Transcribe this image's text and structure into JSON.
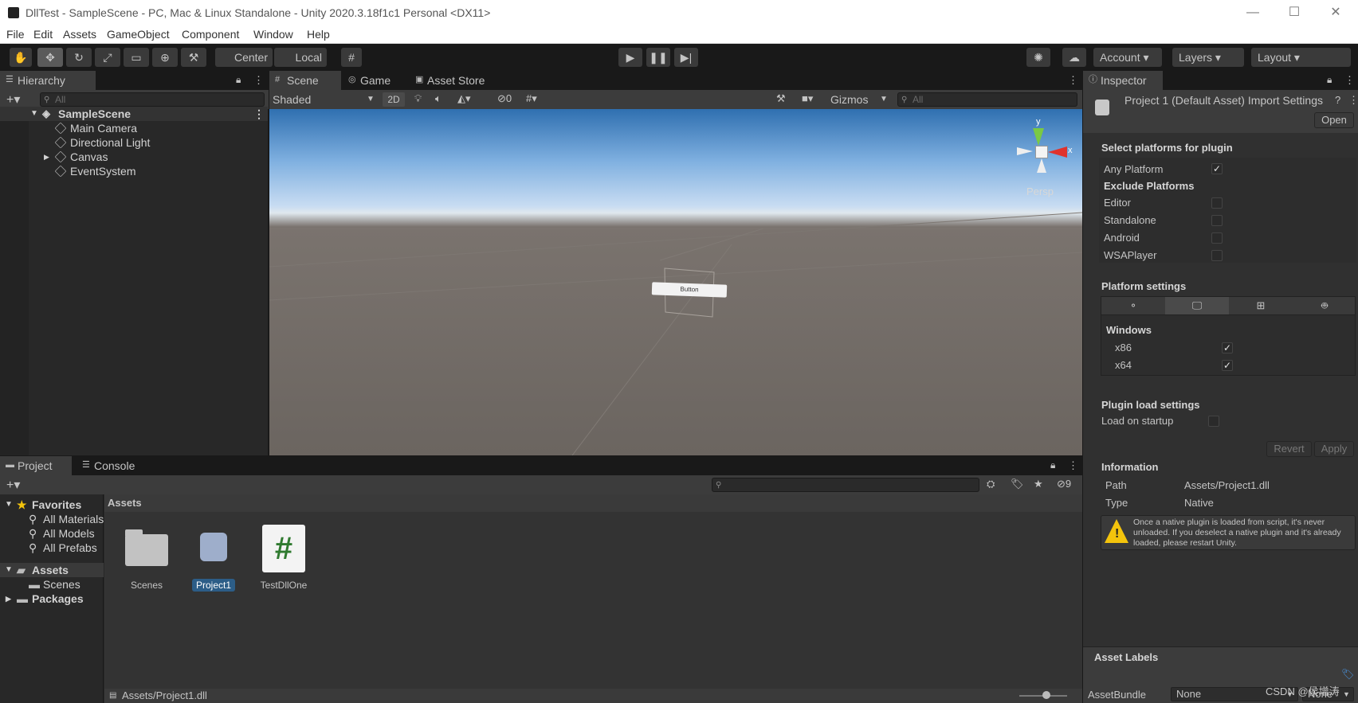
{
  "window": {
    "title": "DllTest - SampleScene - PC, Mac & Linux Standalone - Unity 2020.3.18f1c1 Personal <DX11>",
    "minimize": "—",
    "maximize": "☐",
    "close": "✕"
  },
  "menu": [
    "File",
    "Edit",
    "Assets",
    "GameObject",
    "Component",
    "Window",
    "Help"
  ],
  "toolbar": {
    "center": "Center",
    "local": "Local",
    "account": "Account",
    "layers": "Layers",
    "layout": "Layout"
  },
  "hierarchy": {
    "tab": "Hierarchy",
    "search_placeholder": "All",
    "scene": "SampleScene",
    "items": [
      "Main Camera",
      "Directional Light",
      "Canvas",
      "EventSystem"
    ]
  },
  "scene_view": {
    "tabs": [
      "Scene",
      "Game",
      "Asset Store"
    ],
    "shading": "Shaded",
    "mode2d": "2D",
    "hidden_count": "0",
    "gizmos": "Gizmos",
    "search_placeholder": "All",
    "persp": "Persp",
    "axis_y": "y",
    "axis_x": "x",
    "button_label": "Button"
  },
  "project": {
    "tabs": [
      "Project",
      "Console"
    ],
    "favorites": "Favorites",
    "fav_items": [
      "All Materials",
      "All Models",
      "All Prefabs"
    ],
    "assets_root": "Assets",
    "assets_children": [
      "Scenes"
    ],
    "packages": "Packages",
    "breadcrumb": "Assets",
    "files": [
      "Scenes",
      "Project1",
      "TestDllOne"
    ],
    "hidden_count": "9",
    "status_path": "Assets/Project1.dll"
  },
  "inspector": {
    "tab": "Inspector",
    "header": "Project 1 (Default Asset) Import Settings",
    "open": "Open",
    "select_platforms": "Select platforms for plugin",
    "any_platform": "Any Platform",
    "exclude_platforms": "Exclude Platforms",
    "exclude_items": [
      "Editor",
      "Standalone",
      "Android",
      "WSAPlayer"
    ],
    "platform_settings": "Platform settings",
    "windows": "Windows",
    "arch": [
      "x86",
      "x64"
    ],
    "plugin_load": "Plugin load settings",
    "load_on_startup": "Load on startup",
    "revert": "Revert",
    "apply": "Apply",
    "information": "Information",
    "path_label": "Path",
    "path_value": "Assets/Project1.dll",
    "type_label": "Type",
    "type_value": "Native",
    "warning": "Once a native plugin is loaded from script, it's never unloaded. If you deselect a native plugin and it's already loaded, please restart Unity.",
    "asset_labels": "Asset Labels",
    "asset_bundle": "AssetBundle",
    "bundle_value": "None",
    "variant_value": "None"
  },
  "watermark": "CSDN @侯增涛",
  "colors": {
    "accent": "#2c5d87",
    "selected_file": "#2c5d87",
    "scene_sky": "#c8dcf2",
    "scene_ground": "#6b6560",
    "warning": "#f4c40c"
  }
}
